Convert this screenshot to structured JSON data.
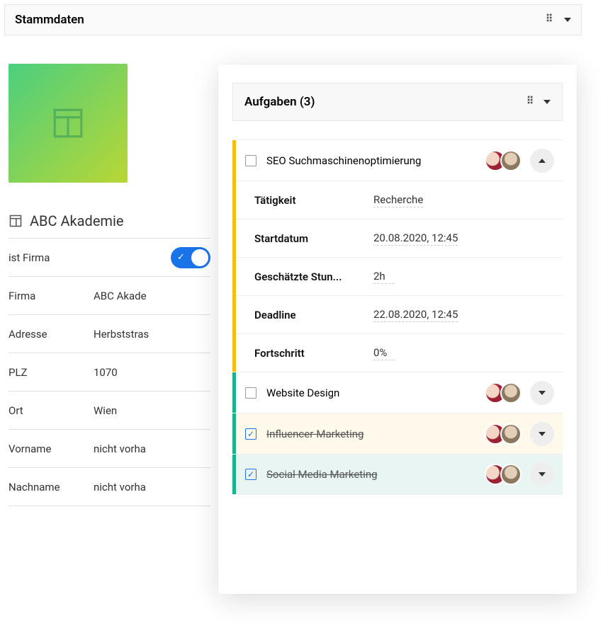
{
  "header": {
    "title": "Stammdaten"
  },
  "left": {
    "company_name": "ABC Akademie",
    "fields": [
      {
        "label": "ist Firma",
        "type": "toggle",
        "on": true
      },
      {
        "label": "Firma",
        "value": "ABC Akade"
      },
      {
        "label": "Adresse",
        "value": "Herbststras"
      },
      {
        "label": "PLZ",
        "value": "1070"
      },
      {
        "label": "Ort",
        "value": "Wien"
      },
      {
        "label": "Vorname",
        "value": "nicht vorha"
      },
      {
        "label": "Nachname",
        "value": "nicht vorha"
      }
    ]
  },
  "panel": {
    "title": "Aufgaben (3)",
    "tasks": [
      {
        "title": "SEO Suchmaschinenoptimierung",
        "done": false,
        "stripe": "yellow",
        "expanded": true,
        "details": [
          {
            "label": "Tätigkeit",
            "value": "Recherche"
          },
          {
            "label": "Startdatum",
            "value": "20.08.2020, 12:45"
          },
          {
            "label": "Geschätzte Stun...",
            "value": "2h"
          },
          {
            "label": "Deadline",
            "value": "22.08.2020, 12:45"
          },
          {
            "label": "Fortschritt",
            "value": "0%"
          }
        ]
      },
      {
        "title": "Website Design",
        "done": false,
        "stripe": "teal",
        "expanded": false
      },
      {
        "title": "Influencer-Marketing",
        "done": true,
        "stripe": "teal",
        "expanded": false,
        "bg": "yellow"
      },
      {
        "title": "Social Media Marketing",
        "done": true,
        "stripe": "teal",
        "expanded": false,
        "bg": "teal"
      }
    ]
  }
}
